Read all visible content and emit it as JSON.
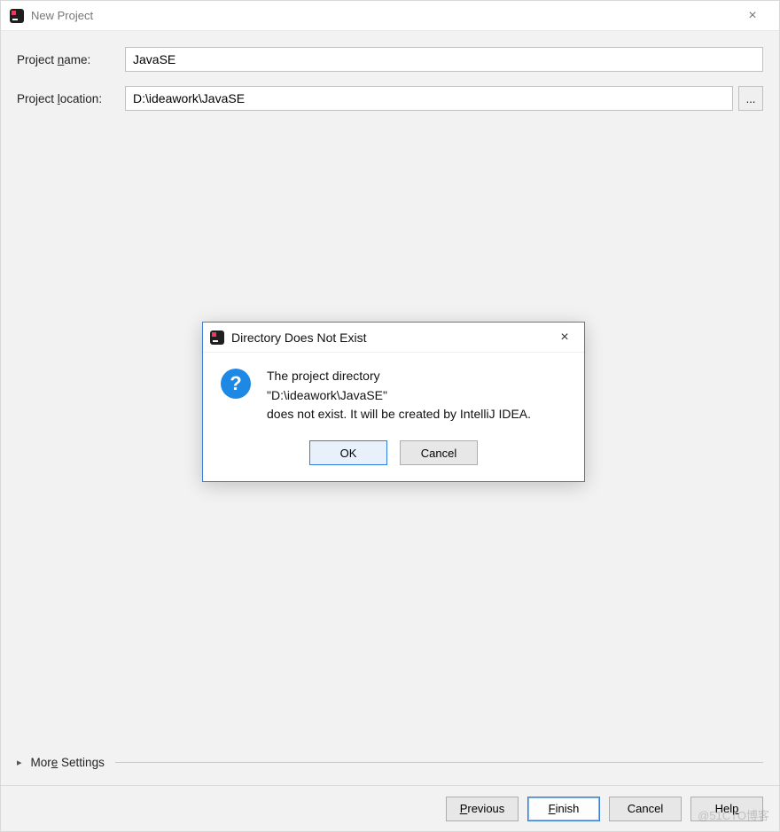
{
  "window": {
    "title": "New Project",
    "close_label": "×"
  },
  "form": {
    "project_name": {
      "label_pre": "Project ",
      "label_u": "n",
      "label_post": "ame:",
      "value": "JavaSE"
    },
    "project_location": {
      "label_pre": "Project ",
      "label_u": "l",
      "label_post": "ocation:",
      "value": "D:\\ideawork\\JavaSE",
      "browse_label": "..."
    }
  },
  "more_settings": {
    "label_pre": "Mor",
    "label_u": "e",
    "label_post": " Settings",
    "triangle": "▸"
  },
  "footer": {
    "previous": {
      "u": "P",
      "rest": "revious"
    },
    "finish": {
      "u": "F",
      "rest": "inish"
    },
    "cancel": "Cancel",
    "help": {
      "pre": "Hel",
      "u": "p"
    }
  },
  "dialog": {
    "title": "Directory Does Not Exist",
    "close_label": "×",
    "line1": "The project directory",
    "line2": "\"D:\\ideawork\\JavaSE\"",
    "line3": "does not exist. It will be created by IntelliJ IDEA.",
    "ok": "OK",
    "cancel": "Cancel",
    "question_mark": "?"
  },
  "watermark": "@51CTO博客"
}
